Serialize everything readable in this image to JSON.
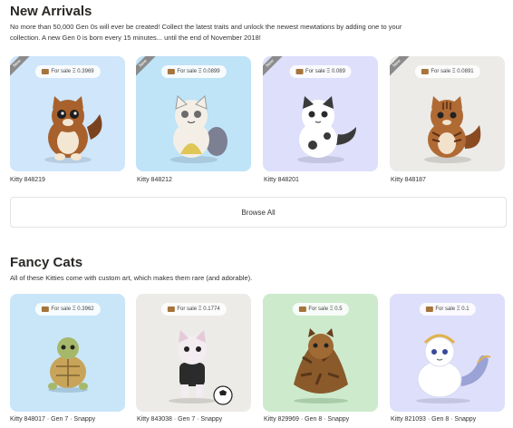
{
  "new_arrivals": {
    "title": "New Arrivals",
    "desc_line1": "No more than 50,000 Gen 0s will ever be created! Collect the latest traits and unlock the newest mewtations by adding one to your",
    "desc_line2": "collection. A new Gen 0 is born every 15 minutes... until the end of November 2018!",
    "tag_label": "New",
    "cards": [
      {
        "price": "For sale Ξ 0.3969",
        "name": "Kitty 848219",
        "bg": "#cfe6fb",
        "body": "#a8612c"
      },
      {
        "price": "For sale Ξ 0.0899",
        "name": "Kitty 848212",
        "bg": "#bfe3f7",
        "body": "#f4efe6"
      },
      {
        "price": "For sale Ξ 0.089",
        "name": "Kitty 848201",
        "bg": "#dedffb",
        "body": "#ffffff"
      },
      {
        "price": "For sale Ξ 0.0891",
        "name": "Kitty 848187",
        "bg": "#ecebe8",
        "body": "#b06a34"
      }
    ],
    "browse_label": "Browse All"
  },
  "fancy_cats": {
    "title": "Fancy Cats",
    "desc": "All of these Kitties come with custom art, which makes them rare (and adorable).",
    "cards": [
      {
        "price": "For sale Ξ 0.3962",
        "name": "Kitty 848017 · Gen 7 · Snappy",
        "bg": "#c9e6f9"
      },
      {
        "price": "For sale Ξ 0.1774",
        "name": "Kitty 843038 · Gen 7 · Snappy",
        "bg": "#ecebe8"
      },
      {
        "price": "For sale Ξ 0.5",
        "name": "Kitty 829969 · Gen 8 · Snappy",
        "bg": "#cdeacd"
      },
      {
        "price": "For sale Ξ 0.1",
        "name": "Kitty 821093 · Gen 8 · Snappy",
        "bg": "#dedffb"
      }
    ]
  },
  "colors": {
    "accent": "#2a2825",
    "tag": "#8b8b8b"
  }
}
